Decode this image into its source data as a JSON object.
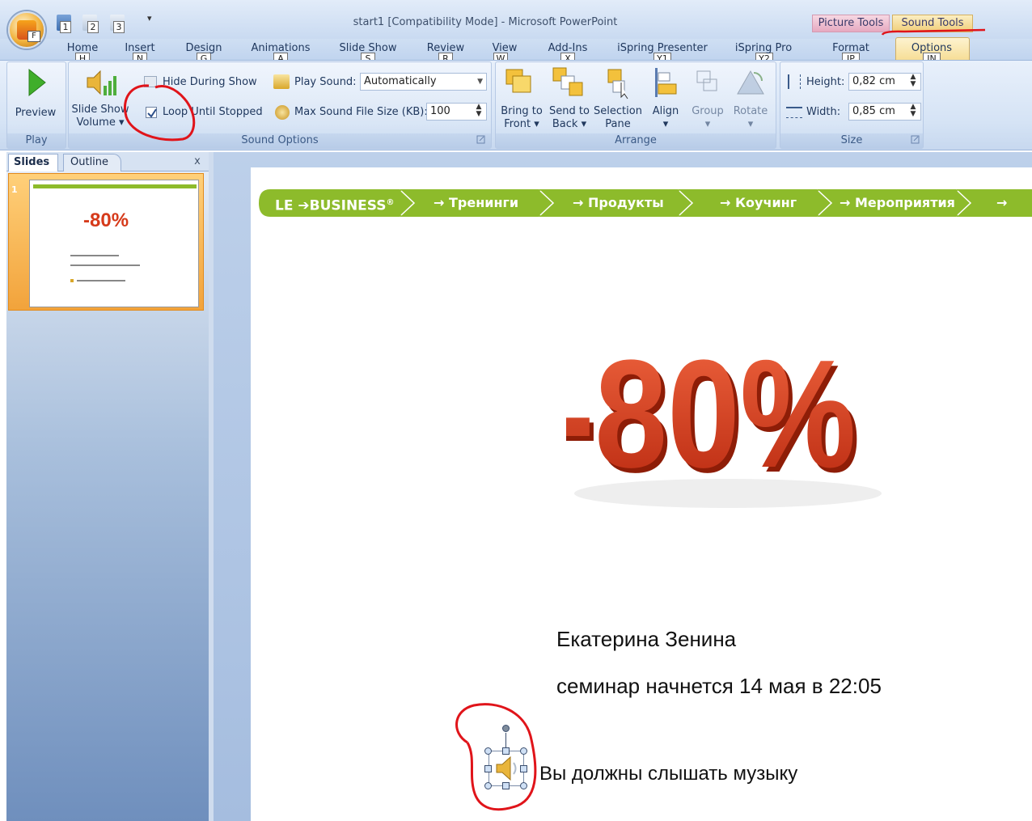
{
  "window": {
    "title": "start1 [Compatibility Mode] - Microsoft PowerPoint"
  },
  "office_button": {
    "key": "F"
  },
  "quick_access": {
    "keys": [
      "1",
      "2",
      "3"
    ],
    "customize_glyph": "▾"
  },
  "contextual": {
    "picture_tools": "Picture Tools",
    "sound_tools": "Sound Tools"
  },
  "tabs": [
    {
      "label": "Home",
      "key": "H"
    },
    {
      "label": "Insert",
      "key": "N"
    },
    {
      "label": "Design",
      "key": "G"
    },
    {
      "label": "Animations",
      "key": "A"
    },
    {
      "label": "Slide Show",
      "key": "S"
    },
    {
      "label": "Review",
      "key": "R"
    },
    {
      "label": "View",
      "key": "W"
    },
    {
      "label": "Add-Ins",
      "key": "X"
    },
    {
      "label": "iSpring Presenter",
      "key": "Y1"
    },
    {
      "label": "iSpring Pro",
      "key": "Y2"
    },
    {
      "label": "Format",
      "key": "JP"
    },
    {
      "label": "Options",
      "key": "JN"
    }
  ],
  "ribbon": {
    "play": {
      "preview": "Preview",
      "group": "Play"
    },
    "sound_options": {
      "slide_show_volume": "Slide Show",
      "slide_show_volume_2": "Volume",
      "hide_during_show": "Hide During Show",
      "loop_until_stopped": "Loop Until Stopped",
      "loop_checked": true,
      "play_sound_label": "Play Sound:",
      "play_sound_value": "Automatically",
      "max_size_label": "Max Sound File Size (KB):",
      "max_size_value": "100",
      "group": "Sound Options"
    },
    "arrange": {
      "bring_front_1": "Bring to",
      "bring_front_2": "Front",
      "send_back_1": "Send to",
      "send_back_2": "Back",
      "selection_1": "Selection",
      "selection_2": "Pane",
      "align": "Align",
      "group_btn": "Group",
      "rotate": "Rotate",
      "group": "Arrange"
    },
    "size": {
      "height_label": "Height:",
      "height_value": "0,82 cm",
      "width_label": "Width:",
      "width_value": "0,85 cm",
      "group": "Size"
    }
  },
  "left_pane": {
    "slides_tab": "Slides",
    "outline_tab": "Outline",
    "close": "x",
    "slide_number": "1"
  },
  "slide": {
    "nav": {
      "logo": "LE",
      "logo_suffix": "BUSINESS",
      "reg": "®",
      "items": [
        "→ Тренинги",
        "→ Продукты",
        "→ Коучинг",
        "→ Мероприятия",
        "→ Рес"
      ]
    },
    "discount": "-80%",
    "speaker_name": "Екатерина Зенина",
    "seminar_line": "семинар начнется 14 мая в 22:05",
    "listen_line": "Вы должны слышать музыку"
  },
  "colors": {
    "nav_green": "#8dbb2b",
    "discount_red": "#d63a1a",
    "annotation_red": "#e0141a"
  }
}
